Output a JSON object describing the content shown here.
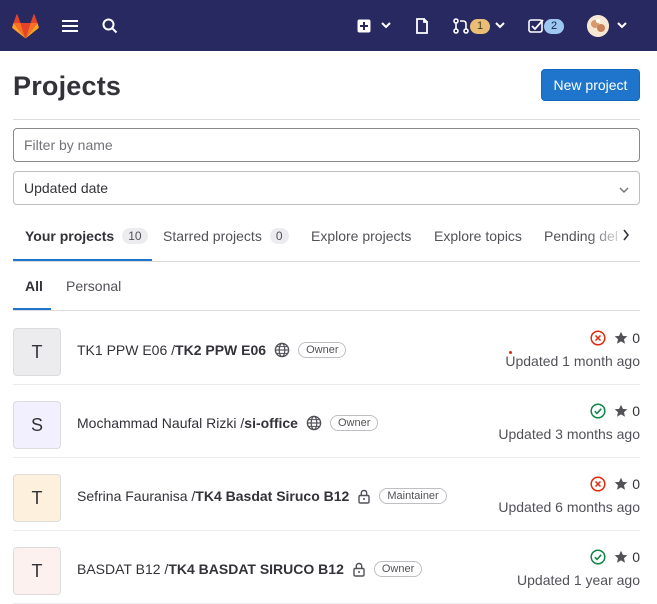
{
  "topbar": {
    "merge_requests_count": "1",
    "todos_count": "2"
  },
  "page": {
    "title": "Projects",
    "new_project_label": "New project"
  },
  "filter": {
    "placeholder": "Filter by name",
    "value": ""
  },
  "sort": {
    "selected": "Updated date"
  },
  "tabs": [
    {
      "label": "Your projects",
      "count": "10"
    },
    {
      "label": "Starred projects",
      "count": "0"
    },
    {
      "label": "Explore projects"
    },
    {
      "label": "Explore topics"
    },
    {
      "label": "Pending deletion"
    }
  ],
  "subtabs": [
    "All",
    "Personal"
  ],
  "projects": [
    {
      "initial": "T",
      "namespace": "TK1 PPW E06 / ",
      "name": "TK2 PPW E06",
      "visibility": "public",
      "role": "Owner",
      "pipeline": "failed",
      "stars": "0",
      "updated": "Updated 1 month ago",
      "avatar_bg": "#ececef"
    },
    {
      "initial": "S",
      "namespace": "Mochammad Naufal Rizki / ",
      "name": "si-office",
      "visibility": "public",
      "role": "Owner",
      "pipeline": "passed",
      "stars": "0",
      "updated": "Updated 3 months ago",
      "avatar_bg": "#f2efff"
    },
    {
      "initial": "T",
      "namespace": "Sefrina Fauranisa / ",
      "name": "TK4 Basdat Siruco B12",
      "visibility": "private",
      "role": "Maintainer",
      "pipeline": "failed",
      "stars": "0",
      "updated": "Updated 6 months ago",
      "avatar_bg": "#fdf1dd"
    },
    {
      "initial": "T",
      "namespace": "BASDAT B12 / ",
      "name": "TK4 BASDAT SIRUCO B12",
      "visibility": "private",
      "role": "Owner",
      "pipeline": "passed",
      "stars": "0",
      "updated": "Updated 1 year ago",
      "avatar_bg": "#fcf1ef"
    }
  ],
  "colors": {
    "topbar": "#292961",
    "primary": "#1f75cb",
    "failed": "#dd2b0e",
    "passed": "#108548"
  }
}
